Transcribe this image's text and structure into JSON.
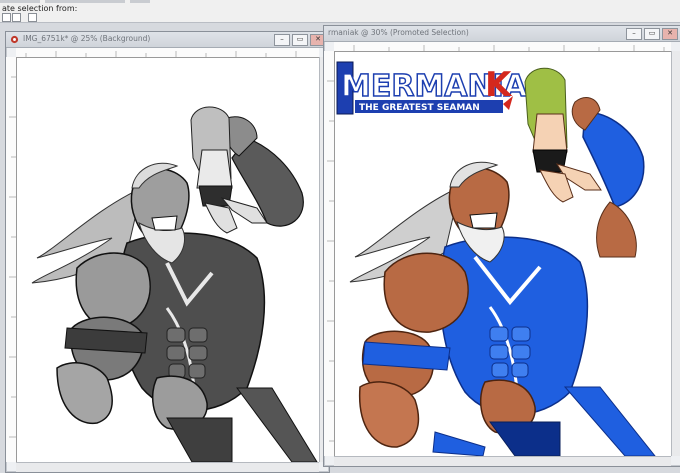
{
  "topbar": {
    "partial_label": "ate selection from:"
  },
  "windows": {
    "left": {
      "title": "IMG_6751k* @  25% (Background)",
      "buttons": {
        "minimize": "–",
        "restore": "▭",
        "close": "✕"
      }
    },
    "right": {
      "title": "rmaniak  @  30% (Promoted Selection)",
      "buttons": {
        "minimize": "–",
        "restore": "▭",
        "close": "✕"
      }
    }
  },
  "artwork": {
    "logo_text": "MERMANIA",
    "logo_accent_letter": "K",
    "tagline": "THE GREATEST SEAMAN"
  },
  "colors": {
    "suit_blue": "#1f5fe0",
    "suit_dark_blue": "#0c2f8a",
    "skin": "#b86a44",
    "hair_girl": "#9fbf45",
    "logo_blue": "#1d3fb0",
    "logo_red": "#d4281e"
  }
}
